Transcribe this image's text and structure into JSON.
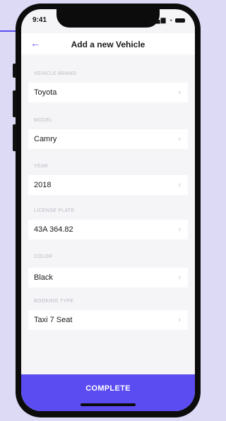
{
  "status": {
    "time": "9:41"
  },
  "header": {
    "title": "Add a new Vehicle"
  },
  "fields": [
    {
      "label": "VEHICLE BRAND",
      "value": "Toyota"
    },
    {
      "label": "MODEL",
      "value": "Camry"
    },
    {
      "label": "YEAR",
      "value": "2018"
    },
    {
      "label": "LICENSE PLATE",
      "value": "43A 364.82"
    },
    {
      "label": "COLOR",
      "value": "Black"
    },
    {
      "label": "BOOKING TYPE",
      "value": "Taxi 7 Seat"
    }
  ],
  "footer": {
    "complete_label": "COMPLETE"
  },
  "icons": {
    "back": "back-arrow-icon",
    "chevron": "chevron-right-icon"
  },
  "colors": {
    "accent": "#5b4cf2",
    "background": "#f5f5f8"
  }
}
